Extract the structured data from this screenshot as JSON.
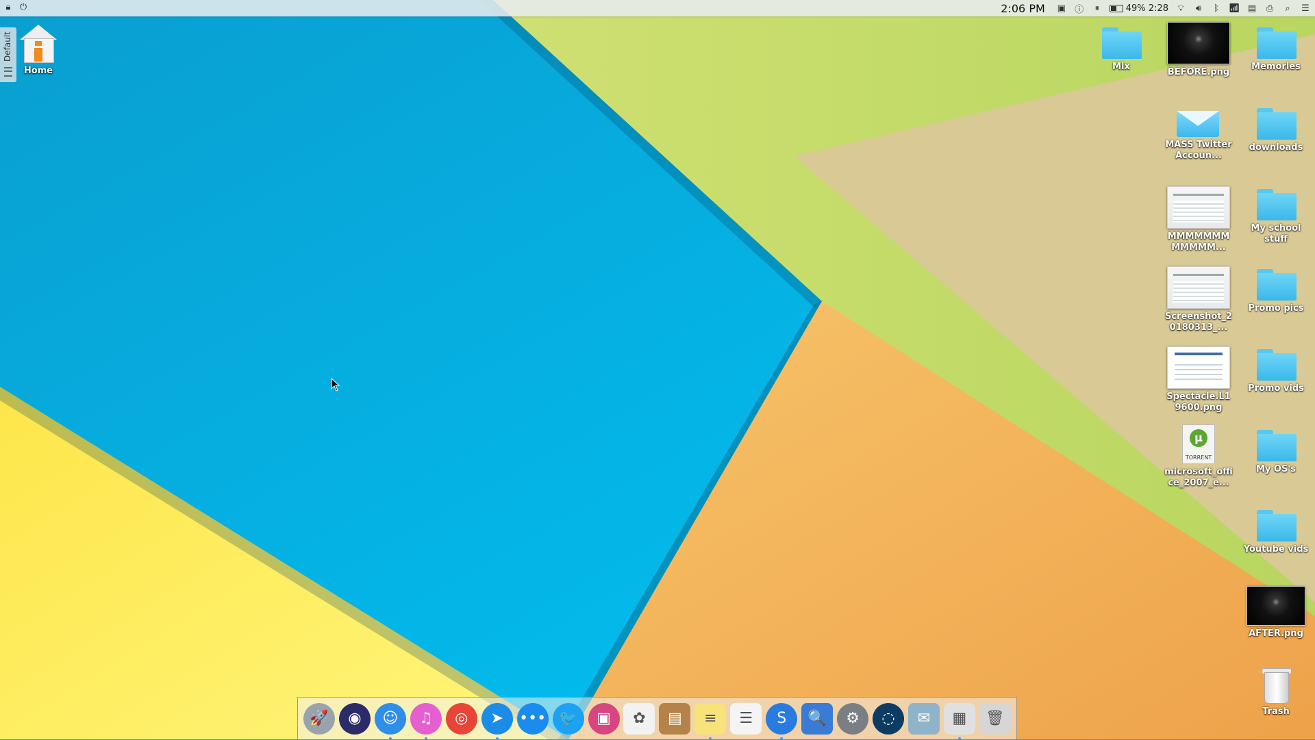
{
  "menubar": {
    "clock": "2:06 PM",
    "battery_percent": 49,
    "battery_text": "49% 2:28"
  },
  "activity_tab": {
    "label": "Default"
  },
  "desktop": {
    "home": {
      "label": "Home"
    },
    "icons": {
      "mix": {
        "label": "Mix"
      },
      "before": {
        "label": "BEFORE.png"
      },
      "memories": {
        "label": "Memories"
      },
      "mass_twitter": {
        "label": "MASS Twitter Accoun..."
      },
      "downloads": {
        "label": "downloads"
      },
      "mmm": {
        "label": "MMMMMMM MMMMM..."
      },
      "school": {
        "label": "My school stuff"
      },
      "screenshot": {
        "label": "Screenshot_2 0180313_..."
      },
      "promo_pics": {
        "label": "Promo pics"
      },
      "spectacle": {
        "label": "Spectacle.L1 9600.png"
      },
      "promo_vids": {
        "label": "Promo vids"
      },
      "office": {
        "label": "microsoft_offi ce_2007_e..."
      },
      "torrent_text": {
        "label": "TORRENT"
      },
      "my_os": {
        "label": "My OS's"
      },
      "youtube": {
        "label": "Youtube vids"
      },
      "after": {
        "label": "AFTER.png"
      },
      "trash": {
        "label": "Trash"
      }
    }
  },
  "dock": {
    "items": [
      {
        "name": "launchpad-icon",
        "glyph": "🚀",
        "bg": "#9aa3ad"
      },
      {
        "name": "siri-icon",
        "glyph": "◉",
        "bg": "#2b2b6a"
      },
      {
        "name": "finder-icon",
        "glyph": "☺",
        "bg": "#2f8fe8"
      },
      {
        "name": "itunes-icon",
        "glyph": "♫",
        "bg": "#e65fd0"
      },
      {
        "name": "chrome-icon",
        "glyph": "◎",
        "bg": "#e64537"
      },
      {
        "name": "safari-icon",
        "glyph": "➤",
        "bg": "#1b8de8"
      },
      {
        "name": "messages-icon",
        "glyph": "•••",
        "bg": "#1a8cf0"
      },
      {
        "name": "twitter-icon",
        "glyph": "🐦",
        "bg": "#1da1f2"
      },
      {
        "name": "photo-viewer-icon",
        "glyph": "▣",
        "bg": "#d8467f"
      },
      {
        "name": "photos-icon",
        "glyph": "✿",
        "bg": "#f2f2f2"
      },
      {
        "name": "contacts-icon",
        "glyph": "▤",
        "bg": "#b5834a"
      },
      {
        "name": "notes-icon",
        "glyph": "≡",
        "bg": "#f8e27a"
      },
      {
        "name": "reminders-icon",
        "glyph": "☰",
        "bg": "#f4f4f4"
      },
      {
        "name": "simplenote-icon",
        "glyph": "S",
        "bg": "#2a7be0"
      },
      {
        "name": "preview-icon",
        "glyph": "🔍",
        "bg": "#3a7bd5"
      },
      {
        "name": "system-preferences-icon",
        "glyph": "⚙",
        "bg": "#7a7f85"
      },
      {
        "name": "network-icon",
        "glyph": "◌",
        "bg": "#0d3c63"
      },
      {
        "name": "mail-icon",
        "glyph": "✉",
        "bg": "#8fb4c9"
      },
      {
        "name": "calculator-icon",
        "glyph": "▦",
        "bg": "#e0e0e0"
      },
      {
        "name": "dock-trash-icon",
        "glyph": "🗑",
        "bg": "#d6d6d6"
      }
    ]
  }
}
